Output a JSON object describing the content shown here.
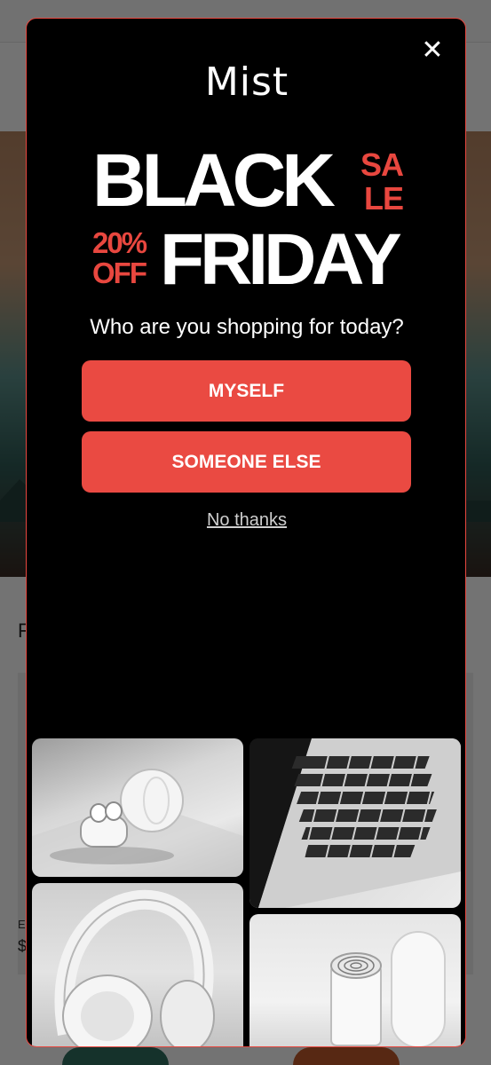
{
  "background": {
    "section_title": "F",
    "card_label": "E",
    "card_price": "$"
  },
  "modal": {
    "brand": "Mist",
    "promo": {
      "line1_big": "BLACK",
      "line1_small_a": "SA",
      "line1_small_b": "LE",
      "line2_small_a": "20%",
      "line2_small_b": "OFF",
      "line2_big": "FRIDAY"
    },
    "question": "Who are you shopping for today?",
    "buttons": {
      "myself": "MYSELF",
      "someone_else": "SOMEONE ELSE"
    },
    "dismiss_link": "No thanks",
    "close_glyph": "✕",
    "images": [
      "earbuds-icon",
      "laptop-icon",
      "headphones-icon",
      "speaker-icon"
    ]
  },
  "colors": {
    "accent": "#ea4a42",
    "modal_background": "#000000",
    "text": "#ffffff"
  }
}
